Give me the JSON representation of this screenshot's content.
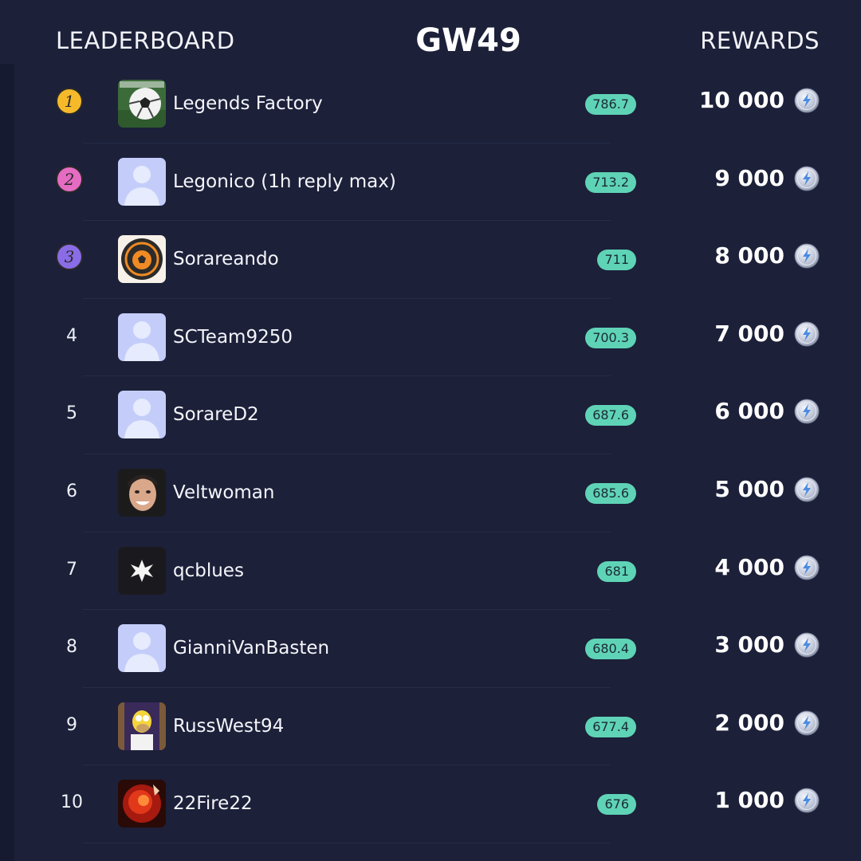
{
  "header": {
    "left_label": "LEADERBOARD",
    "gameweek": "GW49",
    "right_label": "REWARDS"
  },
  "rows": [
    {
      "rank": "1",
      "medal": "gold",
      "name": "Legends Factory",
      "score": "786.7",
      "reward": "10 000",
      "avatar": "soccer-ball-photo"
    },
    {
      "rank": "2",
      "medal": "pink",
      "name": "Legonico (1h reply max)",
      "score": "713.2",
      "reward": "9 000",
      "avatar": "default-user"
    },
    {
      "rank": "3",
      "medal": "purple",
      "name": "Sorareando",
      "score": "711",
      "reward": "8 000",
      "avatar": "sorareando-logo"
    },
    {
      "rank": "4",
      "medal": "",
      "name": "SCTeam9250",
      "score": "700.3",
      "reward": "7 000",
      "avatar": "default-user"
    },
    {
      "rank": "5",
      "medal": "",
      "name": "SorareD2",
      "score": "687.6",
      "reward": "6 000",
      "avatar": "default-user"
    },
    {
      "rank": "6",
      "medal": "",
      "name": "Veltwoman",
      "score": "685.6",
      "reward": "5 000",
      "avatar": "face-photo"
    },
    {
      "rank": "7",
      "medal": "",
      "name": "qcblues",
      "score": "681",
      "reward": "4 000",
      "avatar": "cross-logo"
    },
    {
      "rank": "8",
      "medal": "",
      "name": "GianniVanBasten",
      "score": "680.4",
      "reward": "3 000",
      "avatar": "default-user"
    },
    {
      "rank": "9",
      "medal": "",
      "name": "RussWest94",
      "score": "677.4",
      "reward": "2 000",
      "avatar": "cartoon-character"
    },
    {
      "rank": "10",
      "medal": "",
      "name": "22Fire22",
      "score": "676",
      "reward": "1 000",
      "avatar": "fire-photo"
    }
  ],
  "colors": {
    "background": "#1c2039",
    "score_badge": "#5fd3b6",
    "gold_medal": "#f5b92a",
    "pink_medal": "#e56cc2",
    "purple_medal": "#8a6ce6",
    "default_avatar": "#c4cdfa"
  },
  "icons": {
    "reward_coin": "silver-lightning-coin-icon"
  }
}
